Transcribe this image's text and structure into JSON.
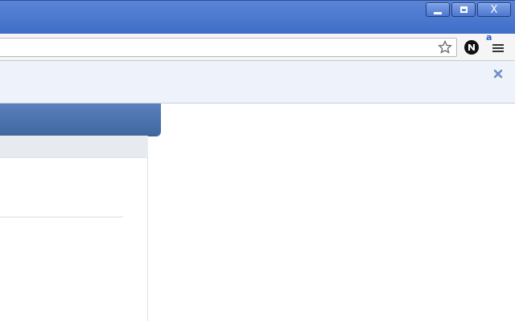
{
  "window": {
    "controls": {
      "minimize": "",
      "maximize": "",
      "close": "X"
    }
  },
  "toolbar": {
    "address": "",
    "badge": "a"
  },
  "icons": {
    "star": "star-icon",
    "extension": "n-extension-icon",
    "menu": "hamburger-menu-icon",
    "close": "close-icon"
  },
  "colors": {
    "titlebar": "#4b78cf",
    "toolbar": "#f5f5f5",
    "infobar": "#eef2fb",
    "header": "#4a71aa",
    "content": "#ffffff"
  }
}
